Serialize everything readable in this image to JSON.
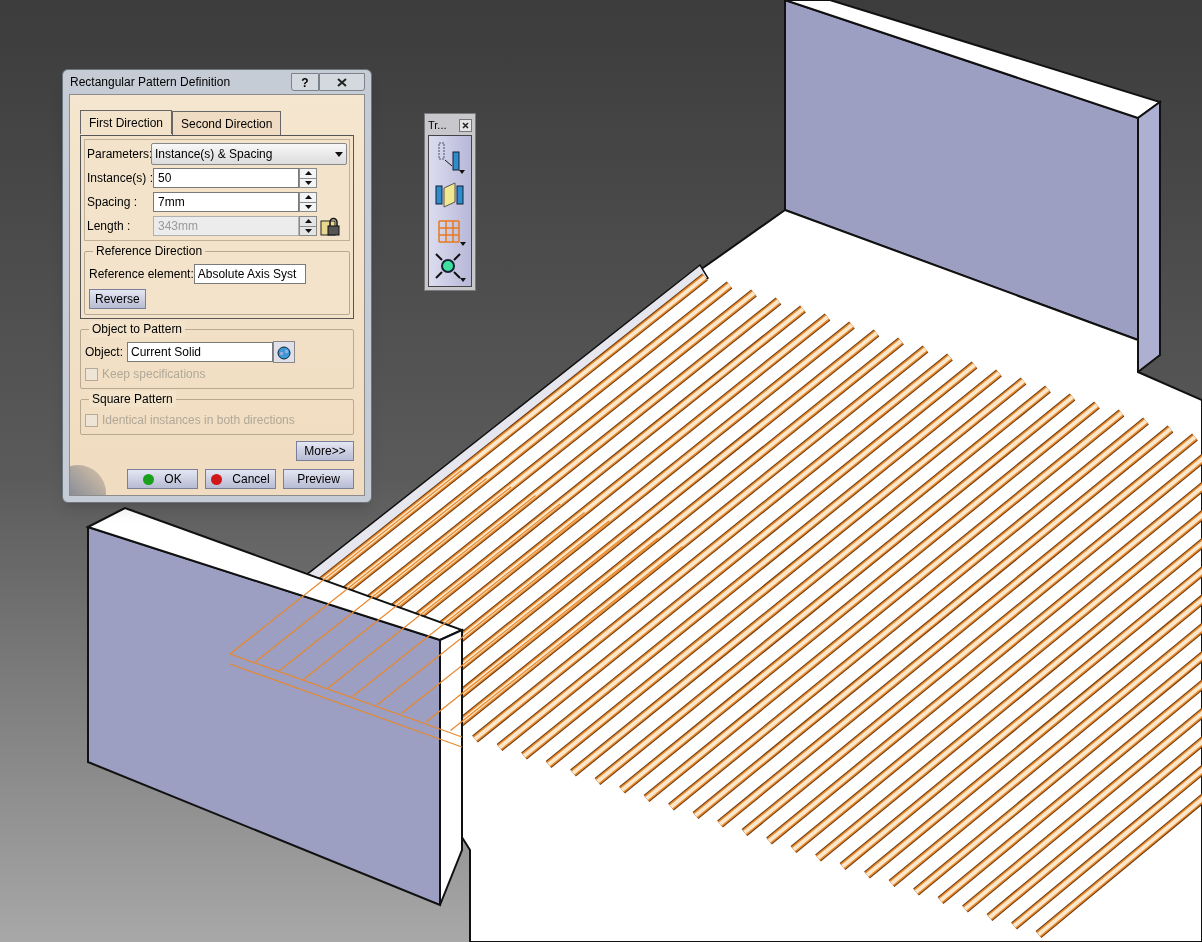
{
  "dialog": {
    "title": "Rectangular Pattern Definition",
    "help_button": "?",
    "tabs": [
      {
        "label": "First Direction",
        "selected": true
      },
      {
        "label": "Second Direction",
        "selected": false
      }
    ],
    "parameters": {
      "label": "Parameters:",
      "value": "Instance(s) & Spacing"
    },
    "instances": {
      "label": "Instance(s) :",
      "value": "50",
      "disabled": false
    },
    "spacing": {
      "label": "Spacing :",
      "value": "7mm",
      "disabled": false
    },
    "length": {
      "label": "Length :",
      "value": "343mm",
      "disabled": true
    },
    "reference_direction": {
      "title": "Reference Direction",
      "label": "Reference element:",
      "value": "Absolute Axis Syst",
      "button": "Reverse"
    },
    "object_to_pattern": {
      "title": "Object to Pattern",
      "label": "Object:",
      "value": "Current Solid",
      "keep_specifications": {
        "label": "Keep specifications",
        "checked": false,
        "disabled": true
      }
    },
    "square_pattern": {
      "title": "Square Pattern",
      "identical": {
        "label": "Identical instances in both directions",
        "checked": false,
        "disabled": true
      }
    },
    "more_button": "More>>",
    "buttons": [
      {
        "kind": "ok",
        "label": "OK"
      },
      {
        "kind": "cancel",
        "label": "Cancel"
      },
      {
        "kind": "preview",
        "label": "Preview"
      }
    ]
  },
  "toolbar": {
    "title": "Tr..."
  }
}
